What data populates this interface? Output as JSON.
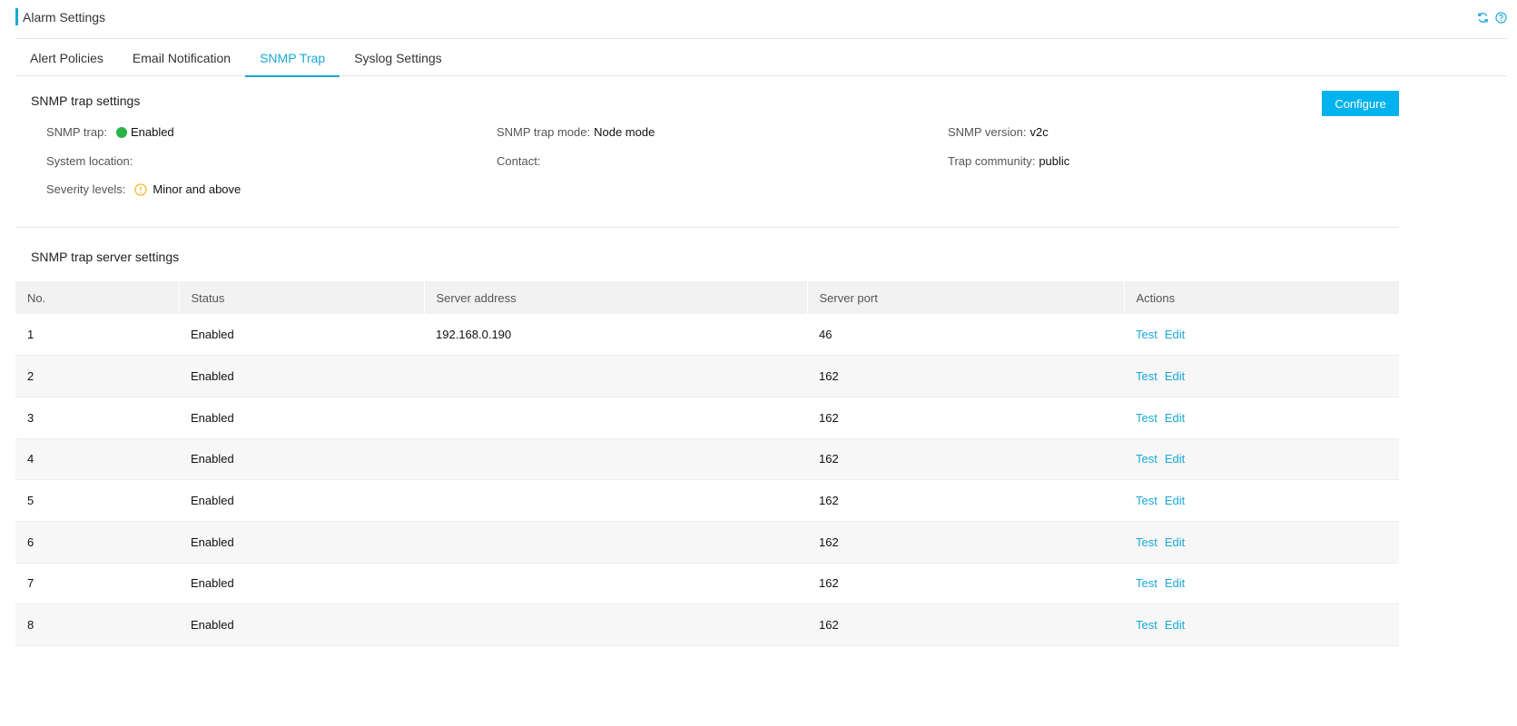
{
  "header": {
    "title": "Alarm Settings",
    "icons": [
      "refresh-icon",
      "help-icon"
    ],
    "accent_color": "#1aa8d6"
  },
  "tabs": [
    {
      "label": "Alert Policies",
      "active": false
    },
    {
      "label": "Email Notification",
      "active": false
    },
    {
      "label": "SNMP Trap",
      "active": true
    },
    {
      "label": "Syslog Settings",
      "active": false
    }
  ],
  "trap_settings": {
    "title": "SNMP trap settings",
    "configure_label": "Configure",
    "snmp_trap_label": "SNMP trap:",
    "snmp_trap_value": "Enabled",
    "snmp_trap_status_color": "#2ab34a",
    "mode_label": "SNMP trap mode:",
    "mode_value": "Node mode",
    "version_label": "SNMP version:",
    "version_value": "v2c",
    "location_label": "System location:",
    "location_value": "",
    "contact_label": "Contact:",
    "contact_value": "",
    "community_label": "Trap community:",
    "community_value": "public",
    "severity_label": "Severity levels:",
    "severity_value": "Minor and above",
    "severity_color": "#f5b82e"
  },
  "server_settings": {
    "title": "SNMP trap server settings",
    "columns": [
      "No.",
      "Status",
      "Server address",
      "Server port",
      "Actions"
    ],
    "rows": [
      {
        "no": "1",
        "status": "Enabled",
        "address": "192.168.0.190",
        "port": "46"
      },
      {
        "no": "2",
        "status": "Enabled",
        "address": "",
        "port": "162"
      },
      {
        "no": "3",
        "status": "Enabled",
        "address": "",
        "port": "162"
      },
      {
        "no": "4",
        "status": "Enabled",
        "address": "",
        "port": "162"
      },
      {
        "no": "5",
        "status": "Enabled",
        "address": "",
        "port": "162"
      },
      {
        "no": "6",
        "status": "Enabled",
        "address": "",
        "port": "162"
      },
      {
        "no": "7",
        "status": "Enabled",
        "address": "",
        "port": "162"
      },
      {
        "no": "8",
        "status": "Enabled",
        "address": "",
        "port": "162"
      }
    ],
    "test_label": "Test",
    "edit_label": "Edit"
  }
}
